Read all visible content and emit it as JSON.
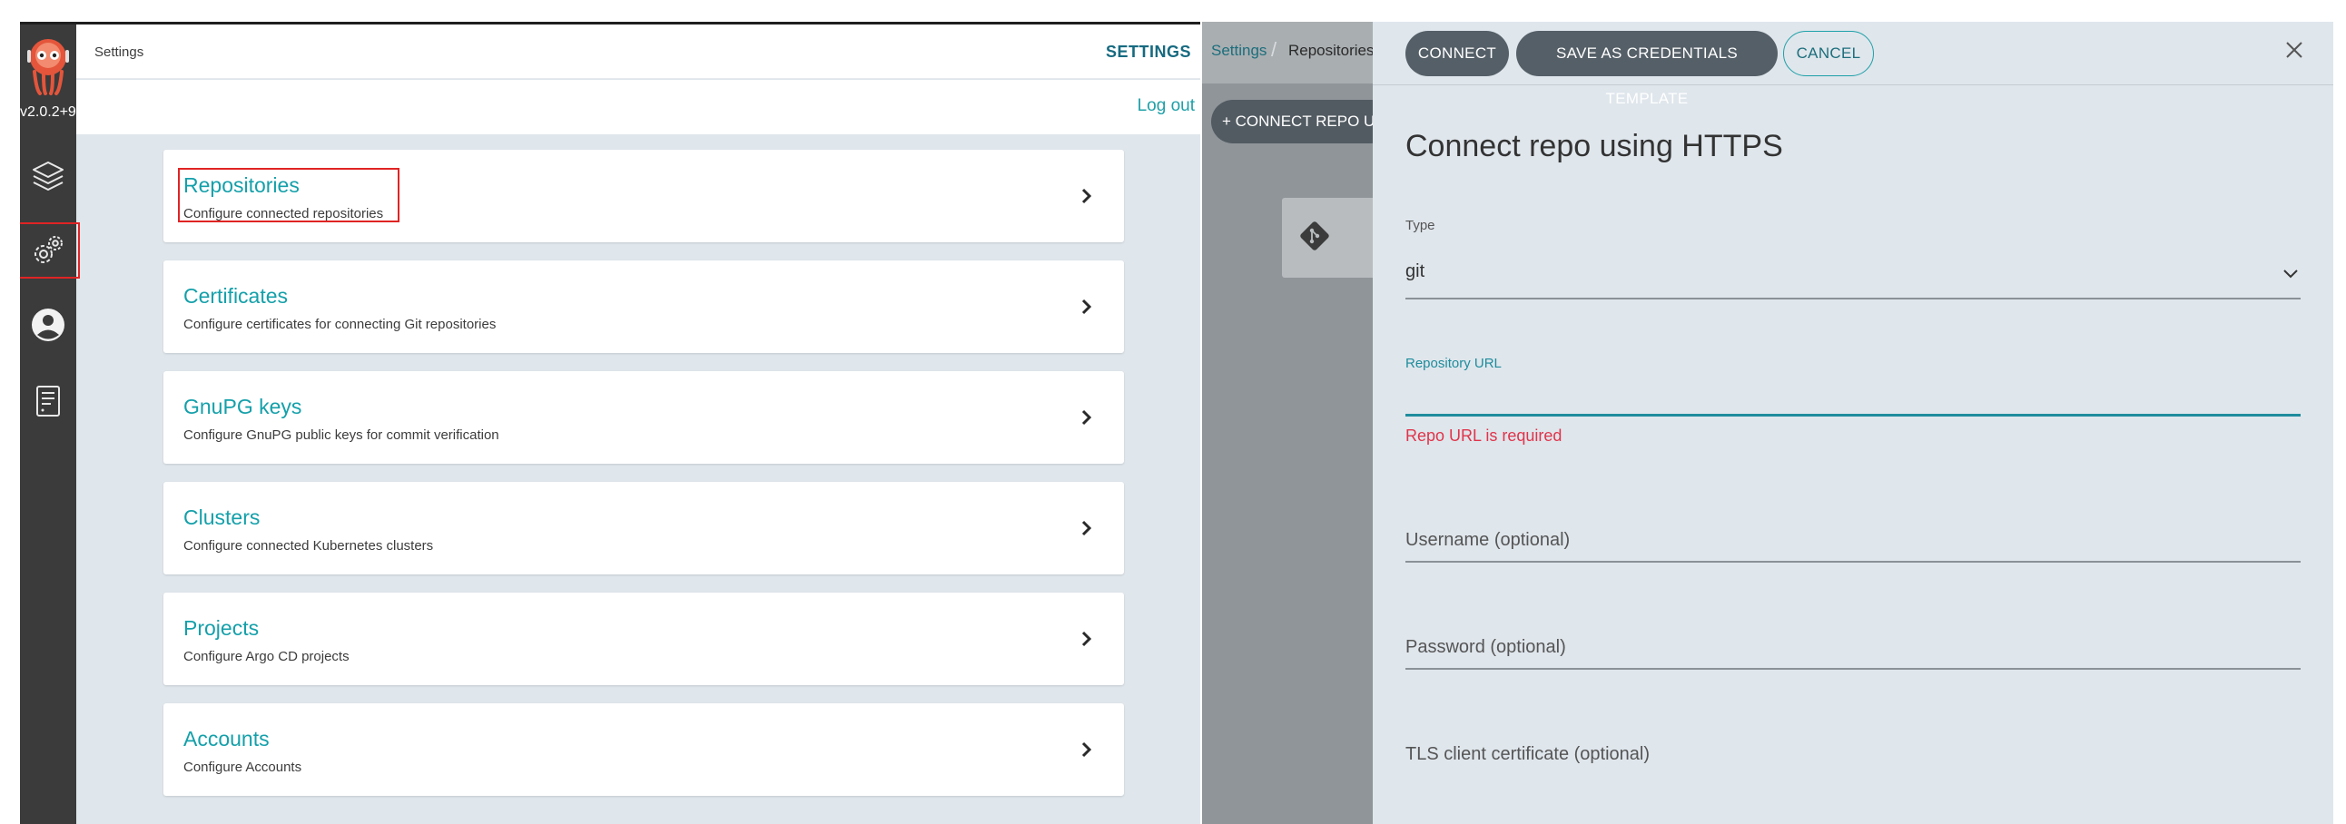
{
  "sidebar": {
    "version": "v2.0.2+9",
    "items": [
      {
        "name": "applications",
        "icon": "layers-icon"
      },
      {
        "name": "settings",
        "icon": "gear-icon",
        "active": true
      },
      {
        "name": "user-info",
        "icon": "user-circle-icon"
      },
      {
        "name": "documentation",
        "icon": "book-icon"
      }
    ]
  },
  "header": {
    "page_title": "Settings",
    "settings_link": "SETTINGS",
    "logout": "Log out"
  },
  "cards": [
    {
      "title": "Repositories",
      "desc": "Configure connected repositories",
      "highlighted": true
    },
    {
      "title": "Certificates",
      "desc": "Configure certificates for connecting Git repositories"
    },
    {
      "title": "GnuPG keys",
      "desc": "Configure GnuPG public keys for commit verification"
    },
    {
      "title": "Clusters",
      "desc": "Configure connected Kubernetes clusters"
    },
    {
      "title": "Projects",
      "desc": "Configure Argo CD projects"
    },
    {
      "title": "Accounts",
      "desc": "Configure Accounts"
    }
  ],
  "repos_page": {
    "breadcrumb": {
      "settings": "Settings",
      "separator": "/",
      "current": "Repositories"
    },
    "connect_button": "+ CONNECT REPO USING HTTPS"
  },
  "drawer": {
    "buttons": {
      "connect": "CONNECT",
      "save_template": "SAVE AS CREDENTIALS TEMPLATE",
      "cancel": "CANCEL"
    },
    "title": "Connect repo using HTTPS",
    "type_label": "Type",
    "type_value": "git",
    "repo_url_label": "Repository URL",
    "repo_url_value": "",
    "repo_url_error": "Repo URL is required",
    "username_placeholder": "Username (optional)",
    "password_placeholder": "Password (optional)",
    "tls_cert_placeholder": "TLS client certificate (optional)"
  },
  "colors": {
    "accent": "#14a0aa",
    "sidebar_bg": "#3b3b3b",
    "error": "#e0344a",
    "button_dark": "#555f67",
    "highlight": "#e02424"
  }
}
